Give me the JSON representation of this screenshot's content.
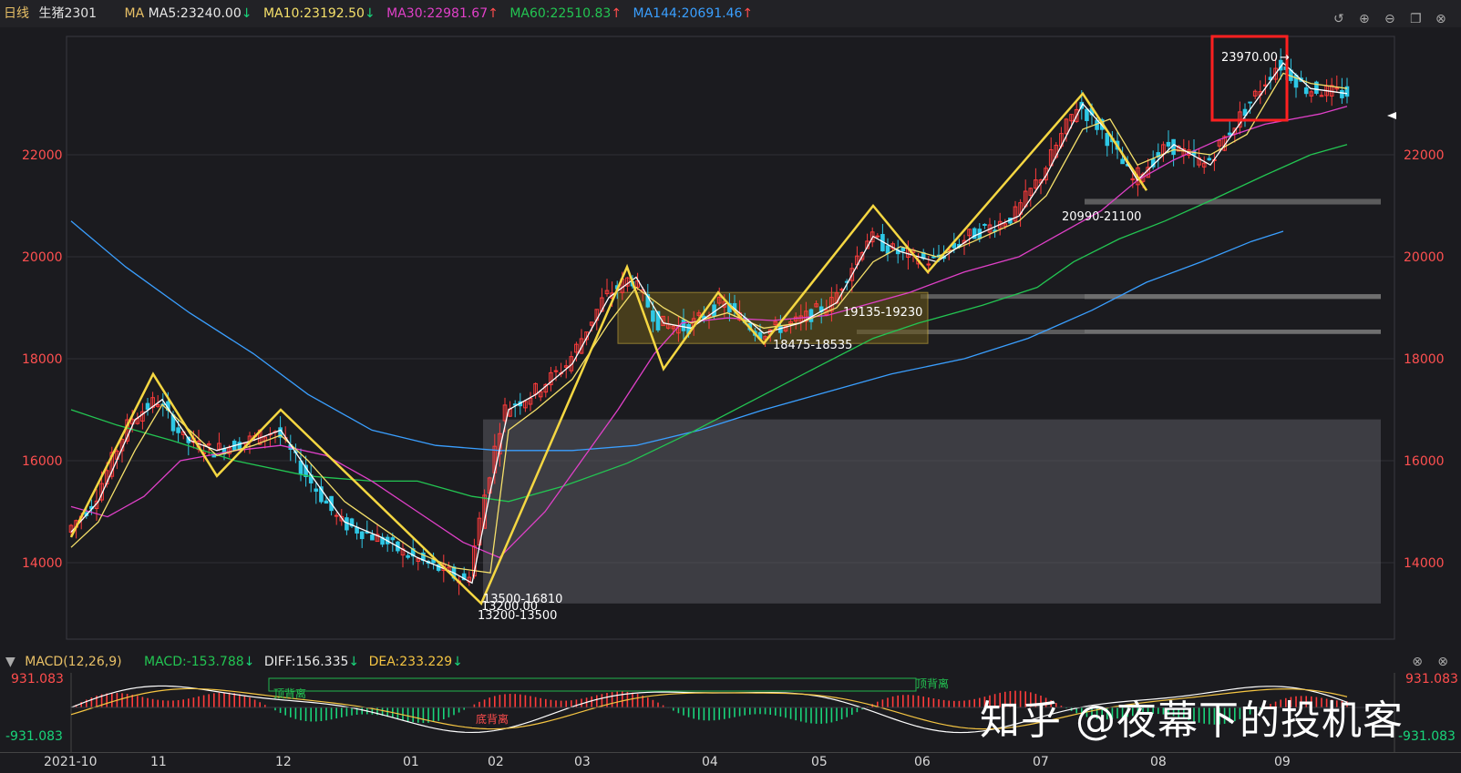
{
  "header": {
    "period": "日线",
    "symbol": "生猪2301",
    "ma_label": "MA",
    "ma5": "MA5:23240.00",
    "ma10": "MA10:23192.50",
    "ma30": "MA30:22981.67",
    "ma60": "MA60:22510.83",
    "ma144": "MA144:20691.46",
    "ma5_color": "#ffffff",
    "ma10_color": "#f5e06a",
    "ma30_color": "#e040c8",
    "ma60_color": "#23c552",
    "ma144_color": "#3a9fff"
  },
  "toolbar_icons": [
    "undo-icon",
    "zoom-in-icon",
    "zoom-out-icon",
    "window-icon",
    "close-icon"
  ],
  "price_axis": {
    "ticks": [
      "22000",
      "20000",
      "18000",
      "16000",
      "14000"
    ],
    "tick_values": [
      22000,
      20000,
      18000,
      16000,
      14000
    ]
  },
  "annotations": {
    "high": "23970.00",
    "zone1": "20990-21100",
    "zone2": "19135-19230",
    "zone3": "18475-18535",
    "zone4": "13500-16810",
    "low": "13200.00",
    "zone5": "13200-13500"
  },
  "macd": {
    "label": "MACD(12,26,9)",
    "macd": "MACD:-153.788",
    "diff": "DIFF:156.335",
    "dea": "DEA:233.229",
    "ymax": "931.083",
    "ymin": "-931.083",
    "div_top": "顶背离",
    "div_bottom": "底背离",
    "div_top_mid": "顶背离"
  },
  "x_axis": [
    "2021-10",
    "11",
    "12",
    "01",
    "02",
    "03",
    "04",
    "05",
    "06",
    "07",
    "08",
    "09"
  ],
  "watermark": "知乎 @夜幕下的投机客",
  "chart_data": {
    "type": "candlestick",
    "price_range": [
      13000,
      24000
    ],
    "ma144": [
      [
        0,
        20700
      ],
      [
        60,
        19800
      ],
      [
        130,
        18900
      ],
      [
        200,
        18100
      ],
      [
        260,
        17300
      ],
      [
        330,
        16600
      ],
      [
        400,
        16300
      ],
      [
        470,
        16200
      ],
      [
        550,
        16200
      ],
      [
        620,
        16300
      ],
      [
        690,
        16600
      ],
      [
        760,
        17000
      ],
      [
        830,
        17350
      ],
      [
        900,
        17700
      ],
      [
        980,
        18000
      ],
      [
        1050,
        18400
      ],
      [
        1120,
        18950
      ],
      [
        1180,
        19500
      ],
      [
        1240,
        19900
      ],
      [
        1295,
        20300
      ],
      [
        1330,
        20500
      ]
    ],
    "ma60": [
      [
        0,
        17000
      ],
      [
        50,
        16700
      ],
      [
        110,
        16400
      ],
      [
        180,
        16000
      ],
      [
        260,
        15700
      ],
      [
        330,
        15600
      ],
      [
        380,
        15600
      ],
      [
        440,
        15300
      ],
      [
        480,
        15200
      ],
      [
        540,
        15500
      ],
      [
        610,
        15950
      ],
      [
        680,
        16550
      ],
      [
        750,
        17200
      ],
      [
        820,
        17850
      ],
      [
        880,
        18400
      ],
      [
        930,
        18700
      ],
      [
        1000,
        19050
      ],
      [
        1060,
        19400
      ],
      [
        1100,
        19900
      ],
      [
        1150,
        20350
      ],
      [
        1200,
        20700
      ],
      [
        1250,
        21100
      ],
      [
        1310,
        21600
      ],
      [
        1360,
        22000
      ],
      [
        1400,
        22200
      ]
    ],
    "ma30": [
      [
        0,
        15100
      ],
      [
        40,
        14900
      ],
      [
        80,
        15300
      ],
      [
        120,
        16000
      ],
      [
        180,
        16200
      ],
      [
        230,
        16300
      ],
      [
        280,
        16100
      ],
      [
        330,
        15600
      ],
      [
        380,
        15000
      ],
      [
        430,
        14400
      ],
      [
        470,
        14100
      ],
      [
        520,
        15000
      ],
      [
        560,
        16000
      ],
      [
        600,
        17000
      ],
      [
        640,
        18100
      ],
      [
        670,
        18700
      ],
      [
        720,
        18800
      ],
      [
        770,
        18750
      ],
      [
        830,
        18850
      ],
      [
        880,
        19100
      ],
      [
        920,
        19300
      ],
      [
        980,
        19700
      ],
      [
        1040,
        20000
      ],
      [
        1080,
        20400
      ],
      [
        1130,
        20900
      ],
      [
        1170,
        21500
      ],
      [
        1210,
        21900
      ],
      [
        1260,
        22300
      ],
      [
        1310,
        22600
      ],
      [
        1370,
        22800
      ],
      [
        1400,
        22950
      ]
    ],
    "ma10": [
      [
        0,
        14300
      ],
      [
        30,
        14800
      ],
      [
        70,
        16200
      ],
      [
        100,
        17100
      ],
      [
        130,
        16600
      ],
      [
        160,
        16100
      ],
      [
        200,
        16300
      ],
      [
        230,
        16500
      ],
      [
        260,
        16000
      ],
      [
        300,
        15200
      ],
      [
        340,
        14700
      ],
      [
        380,
        14200
      ],
      [
        420,
        13900
      ],
      [
        460,
        13800
      ],
      [
        480,
        16600
      ],
      [
        510,
        17000
      ],
      [
        550,
        17600
      ],
      [
        590,
        18700
      ],
      [
        620,
        19400
      ],
      [
        650,
        19000
      ],
      [
        680,
        18700
      ],
      [
        720,
        18900
      ],
      [
        760,
        18600
      ],
      [
        800,
        18700
      ],
      [
        840,
        19000
      ],
      [
        880,
        19900
      ],
      [
        910,
        20200
      ],
      [
        950,
        20000
      ],
      [
        990,
        20300
      ],
      [
        1040,
        20700
      ],
      [
        1070,
        21200
      ],
      [
        1110,
        22500
      ],
      [
        1140,
        22700
      ],
      [
        1170,
        21800
      ],
      [
        1210,
        22100
      ],
      [
        1250,
        22000
      ],
      [
        1290,
        22400
      ],
      [
        1330,
        23600
      ],
      [
        1360,
        23400
      ],
      [
        1400,
        23300
      ]
    ],
    "ma5": [
      [
        0,
        14600
      ],
      [
        30,
        15200
      ],
      [
        70,
        16800
      ],
      [
        100,
        17200
      ],
      [
        130,
        16400
      ],
      [
        160,
        16200
      ],
      [
        200,
        16400
      ],
      [
        230,
        16600
      ],
      [
        260,
        15800
      ],
      [
        300,
        14800
      ],
      [
        340,
        14500
      ],
      [
        380,
        14100
      ],
      [
        420,
        13800
      ],
      [
        440,
        13600
      ],
      [
        460,
        15400
      ],
      [
        480,
        17000
      ],
      [
        510,
        17300
      ],
      [
        550,
        17900
      ],
      [
        590,
        19200
      ],
      [
        620,
        19600
      ],
      [
        650,
        18700
      ],
      [
        680,
        18600
      ],
      [
        720,
        19100
      ],
      [
        760,
        18500
      ],
      [
        800,
        18700
      ],
      [
        840,
        19100
      ],
      [
        880,
        20400
      ],
      [
        910,
        20100
      ],
      [
        950,
        19900
      ],
      [
        990,
        20400
      ],
      [
        1040,
        20800
      ],
      [
        1070,
        21600
      ],
      [
        1110,
        23000
      ],
      [
        1140,
        22400
      ],
      [
        1170,
        21500
      ],
      [
        1210,
        22200
      ],
      [
        1250,
        21800
      ],
      [
        1290,
        22800
      ],
      [
        1330,
        23800
      ],
      [
        1360,
        23300
      ],
      [
        1400,
        23200
      ]
    ],
    "zigzag": [
      [
        0,
        14500
      ],
      [
        90,
        17700
      ],
      [
        160,
        15700
      ],
      [
        230,
        17000
      ],
      [
        450,
        13200
      ],
      [
        610,
        19800
      ],
      [
        650,
        17800
      ],
      [
        710,
        19300
      ],
      [
        760,
        18300
      ],
      [
        880,
        21000
      ],
      [
        940,
        19700
      ],
      [
        1110,
        23200
      ],
      [
        1180,
        21300
      ]
    ],
    "zones": [
      [
        13200,
        16810
      ],
      [
        18475,
        18535
      ],
      [
        19135,
        19230
      ],
      [
        20990,
        21100
      ]
    ],
    "box": [
      18300,
      19300
    ]
  }
}
